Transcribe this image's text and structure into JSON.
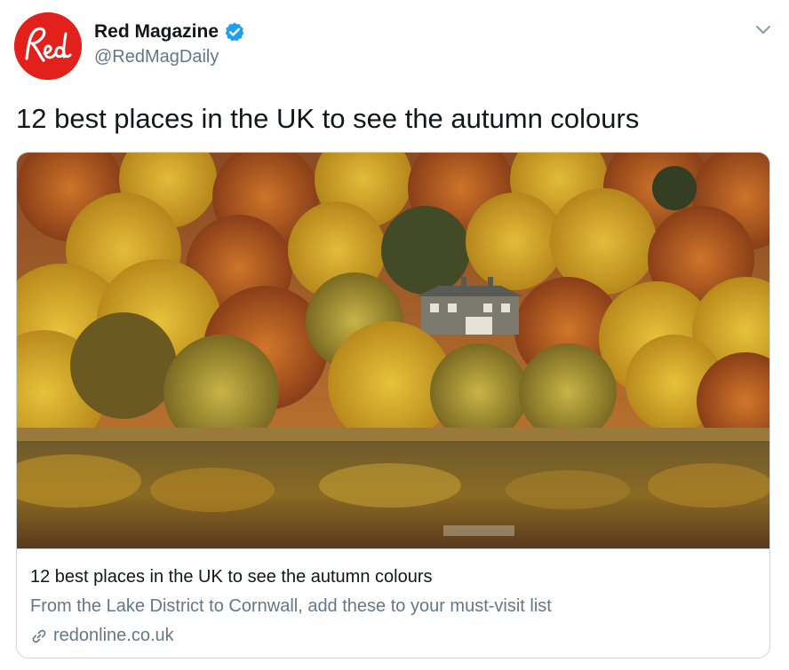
{
  "author": {
    "display_name": "Red Magazine",
    "handle": "@RedMagDaily",
    "verified": true,
    "avatar_text": "Red",
    "avatar_color": "#e2211c"
  },
  "tweet": {
    "text": "12 best places in the UK to see the autumn colours"
  },
  "card": {
    "image_alt": "Autumn trees around a house reflected in a lake",
    "title": "12 best places in the UK to see the autumn colours",
    "description": "From the Lake District to Cornwall, add these to your must-visit list",
    "domain": "redonline.co.uk"
  },
  "icons": {
    "verified": "verified-badge-icon",
    "menu": "chevron-down-icon",
    "link": "link-icon"
  },
  "colors": {
    "verified_blue": "#1da1f2",
    "secondary_text": "#657786",
    "primary_text": "#14171a",
    "border": "#ccd6dd"
  }
}
